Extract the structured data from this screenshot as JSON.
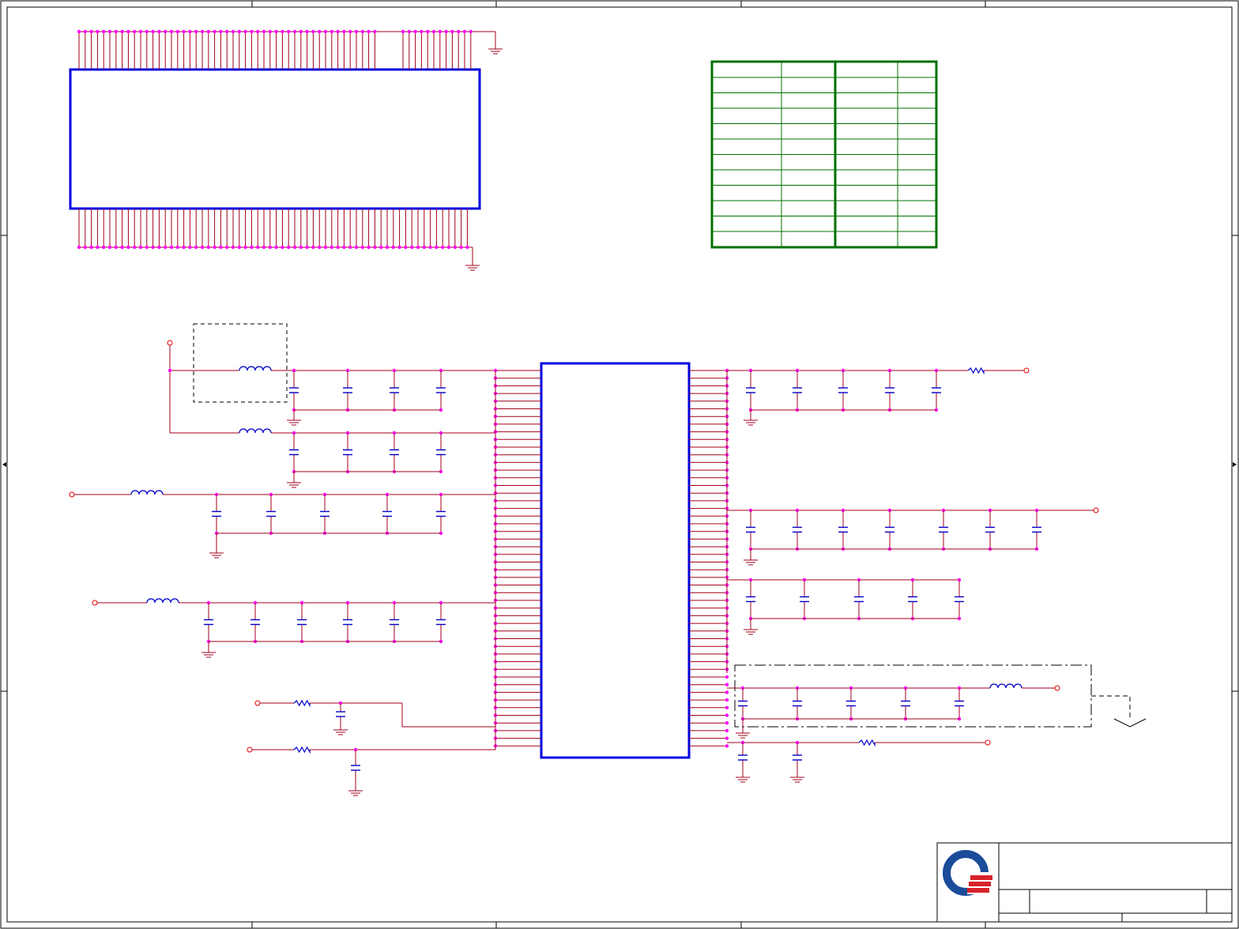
{
  "colors": {
    "wire": "#a0001c",
    "junction": "#ff00ff",
    "component": "#0000c8",
    "ic_outline": "#0000e0",
    "table_outline": "#007000",
    "frame": "#000000",
    "port": "#e00000",
    "logo_blue": "#1a4c9a",
    "logo_red": "#d8232a"
  },
  "icons": {
    "logo": "company-logo-icon",
    "ground": "ground-symbol-icon",
    "capacitor": "capacitor-icon",
    "inductor": "inductor-icon",
    "resistor": "resistor-icon",
    "port": "off-page-port-icon"
  },
  "schematic": {
    "components": {
      "connector_top": "connector-block",
      "main_ic": "main-ic-block",
      "pin_table": "pin-assignment-table",
      "title_block": "title-block"
    }
  }
}
